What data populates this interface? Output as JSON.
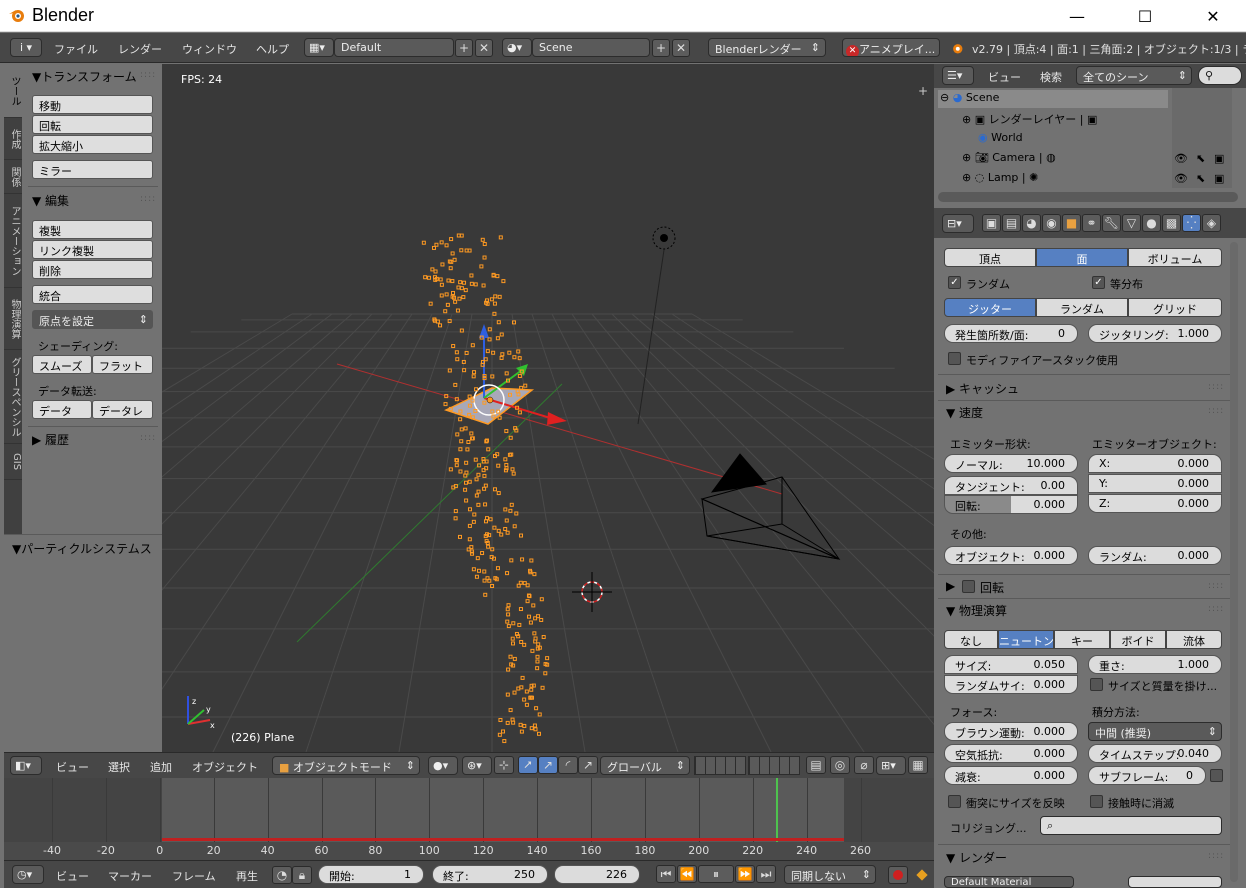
{
  "window": {
    "title": "Blender",
    "minimize": "—",
    "maximize": "☐",
    "close": "✕"
  },
  "menubar": {
    "info_icon": "i",
    "menus": [
      "ファイル",
      "レンダー",
      "ウィンドウ",
      "ヘルプ"
    ],
    "layout": "Default",
    "scene": "Scene",
    "engine": "Blenderレンダー",
    "anim_play": "アニメプレイ...",
    "stats": "v2.79 | 頂点:4 | 面:1 | 三角面:2 | オブジェクト:1/3 | ラ"
  },
  "vtabs": [
    "ツール",
    "作成",
    "関係",
    "アニメーション",
    "物理演算",
    "グリースペンシル",
    "GIS"
  ],
  "toolshelf": {
    "transform_head": "▼トランスフォーム",
    "move": "移動",
    "rotate": "回転",
    "scale": "拡大縮小",
    "mirror": "ミラー",
    "edit_head": "▼ 編集",
    "duplicate": "複製",
    "link_duplicate": "リンク複製",
    "delete": "削除",
    "join": "統合",
    "set_origin": "原点を設定",
    "shading_label": "シェーディング:",
    "smooth": "スムーズ",
    "flat": "フラット",
    "data_transfer_label": "データ転送:",
    "data": "データ",
    "data_layout": "データレ",
    "history_head": "▶ 履歴",
    "particle_head": "▼パーティクルシステムス"
  },
  "viewport": {
    "fps": "FPS: 24",
    "object_label": "(226) Plane"
  },
  "viewheader": {
    "menus": [
      "ビュー",
      "選択",
      "追加",
      "オブジェクト"
    ],
    "mode": "オブジェクトモード",
    "orientation": "グローバル"
  },
  "timeline": {
    "ticks": [
      "-40",
      "-20",
      "0",
      "20",
      "40",
      "60",
      "80",
      "100",
      "120",
      "140",
      "160",
      "180",
      "200",
      "220",
      "240",
      "260"
    ],
    "menus": [
      "ビュー",
      "マーカー",
      "フレーム",
      "再生"
    ],
    "start_label": "開始:",
    "start_val": "1",
    "end_label": "終了:",
    "end_val": "250",
    "current": "226",
    "sync": "同期しない"
  },
  "outliner": {
    "view": "ビュー",
    "search": "検索",
    "filter": "全てのシーン",
    "items": [
      {
        "label": "Scene"
      },
      {
        "label": "レンダーレイヤー"
      },
      {
        "label": "World"
      },
      {
        "label": "Camera"
      },
      {
        "label": "Lamp"
      }
    ]
  },
  "props": {
    "emit_from": [
      "頂点",
      "面",
      "ボリューム"
    ],
    "random_chk": "ランダム",
    "even_chk": "等分布",
    "distribution": [
      "ジッター",
      "ランダム",
      "グリッド"
    ],
    "per_face_label": "発生箇所数/面:",
    "per_face_val": "0",
    "jitter_label": "ジッタリング:",
    "jitter_val": "1.000",
    "modifier_stack": "モディファイアースタック使用",
    "cache_head": "▶ キャッシュ",
    "velocity_head": "▼ 速度",
    "emitter_geom": "エミッター形状:",
    "emitter_obj": "エミッターオブジェクト:",
    "normal_label": "ノーマル:",
    "normal_val": "10.000",
    "x_label": "X:",
    "x_val": "0.000",
    "tangent_label": "タンジェント:",
    "tangent_val": "0.00",
    "y_label": "Y:",
    "y_val": "0.000",
    "rot_label": "回転:",
    "rot_val": "0.000",
    "z_label": "Z:",
    "z_val": "0.000",
    "other_label": "その他:",
    "object_label": "オブジェクト:",
    "object_val": "0.000",
    "random_label": "ランダム:",
    "random_val": "0.000",
    "rotation_head": "回転",
    "physics_head": "▼ 物理演算",
    "physics_types": [
      "なし",
      "ニュートン",
      "キー",
      "ボイド",
      "流体"
    ],
    "size_label": "サイズ:",
    "size_val": "0.050",
    "mass_label": "重さ:",
    "mass_val": "1.000",
    "random_size_label": "ランダムサイ:",
    "random_size_val": "0.000",
    "mult_size": "サイズと質量を掛け...",
    "forces_label": "フォース:",
    "integration_label": "積分方法:",
    "brownian_label": "ブラウン運動:",
    "brownian_val": "0.000",
    "integration_val": "中間 (推奨)",
    "drag_label": "空気抵抗:",
    "drag_val": "0.000",
    "timestep_label": "タイムステップ:",
    "timestep_val": "0.040",
    "damp_label": "減衰:",
    "damp_val": "0.000",
    "subframe_label": "サブフレーム:",
    "subframe_val": "0",
    "size_deflect": "衝突にサイズを反映",
    "die_on_hit": "接触時に消滅",
    "collision": "コリジョング...",
    "render_head": "▼ レンダー",
    "material": "Default Material"
  },
  "colors": {
    "accent": "#5680c2",
    "particle": "#ff9a22",
    "x_axis": "#c83232",
    "y_axis": "#5aa03c"
  }
}
